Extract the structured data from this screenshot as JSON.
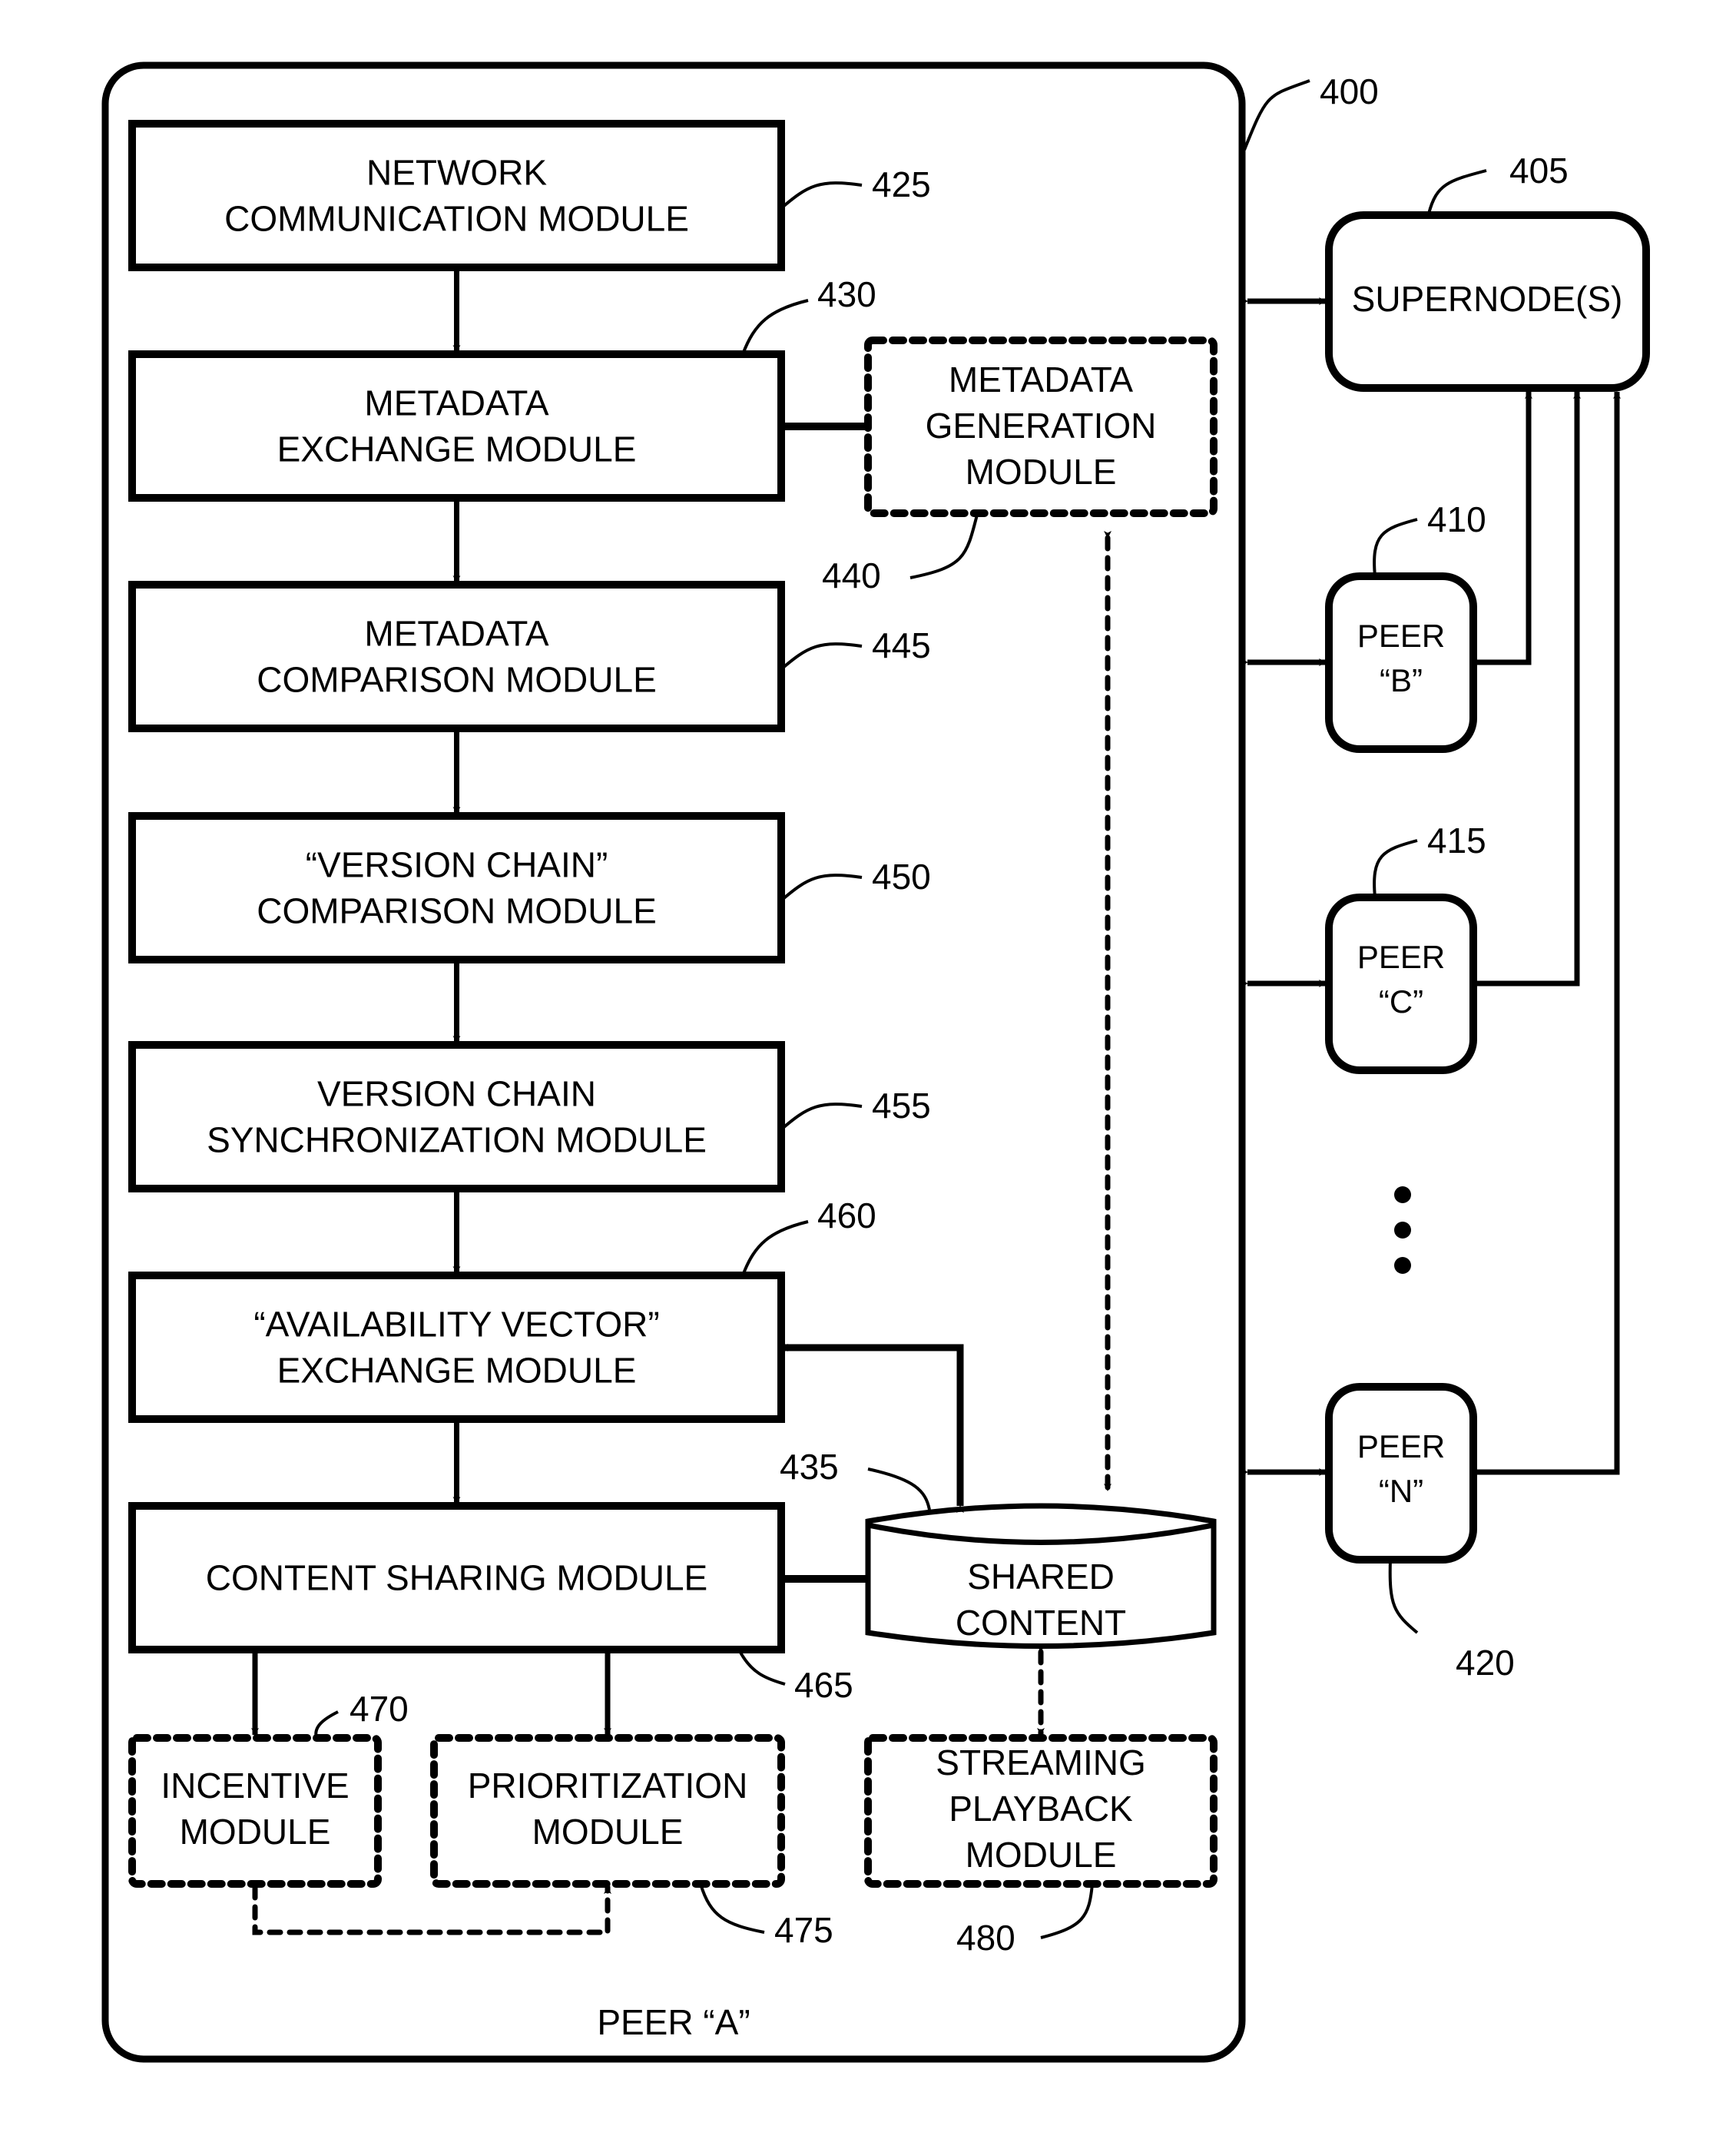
{
  "figure": {
    "container": {
      "label": "PEER “A”",
      "ref": "400"
    },
    "modules": [
      {
        "id": "network-communication",
        "lines": [
          "NETWORK",
          "COMMUNICATION MODULE"
        ],
        "ref": "425",
        "style": "solid"
      },
      {
        "id": "metadata-exchange",
        "lines": [
          "METADATA",
          "EXCHANGE MODULE"
        ],
        "ref": "430",
        "style": "solid"
      },
      {
        "id": "metadata-comparison",
        "lines": [
          "METADATA",
          "COMPARISON MODULE"
        ],
        "ref": "445",
        "style": "solid"
      },
      {
        "id": "version-chain-comparison",
        "lines": [
          "“VERSION CHAIN”",
          "COMPARISON MODULE"
        ],
        "ref": "450",
        "style": "solid"
      },
      {
        "id": "version-chain-sync",
        "lines": [
          "VERSION CHAIN",
          "SYNCHRONIZATION MODULE"
        ],
        "ref": "455",
        "style": "solid"
      },
      {
        "id": "availability-vector-exchange",
        "lines": [
          "“AVAILABILITY VECTOR”",
          "EXCHANGE MODULE"
        ],
        "ref": "460",
        "style": "solid"
      },
      {
        "id": "content-sharing",
        "lines": [
          "CONTENT SHARING MODULE"
        ],
        "ref": "465",
        "style": "solid"
      }
    ],
    "optional_modules": [
      {
        "id": "metadata-generation",
        "lines": [
          "METADATA",
          "GENERATION",
          "MODULE"
        ],
        "ref": "440",
        "style": "dashed"
      },
      {
        "id": "incentive",
        "lines": [
          "INCENTIVE",
          "MODULE"
        ],
        "ref": "470",
        "style": "dashed"
      },
      {
        "id": "prioritization",
        "lines": [
          "PRIORITIZATION",
          "MODULE"
        ],
        "ref": "475",
        "style": "dashed"
      },
      {
        "id": "streaming-playback",
        "lines": [
          "STREAMING",
          "PLAYBACK",
          "MODULE"
        ],
        "ref": "480",
        "style": "dashed"
      }
    ],
    "datastore": {
      "id": "shared-content",
      "lines": [
        "SHARED",
        "CONTENT"
      ],
      "ref": "435"
    },
    "external_nodes": [
      {
        "id": "supernode",
        "lines": [
          "SUPERNODE(S)"
        ],
        "ref": "405"
      },
      {
        "id": "peer-b",
        "lines": [
          "PEER",
          "“B”"
        ],
        "ref": "410"
      },
      {
        "id": "peer-c",
        "lines": [
          "PEER",
          "“C”"
        ],
        "ref": "415"
      },
      {
        "id": "peer-n",
        "lines": [
          "PEER",
          "“N”"
        ],
        "ref": "420"
      }
    ],
    "ellipsis": "⋮",
    "connections": [
      {
        "from": "network-communication",
        "to": "metadata-exchange",
        "type": "solid-arrow"
      },
      {
        "from": "metadata-exchange",
        "to": "metadata-comparison",
        "type": "solid-arrow"
      },
      {
        "from": "metadata-comparison",
        "to": "version-chain-comparison",
        "type": "solid-arrow"
      },
      {
        "from": "version-chain-comparison",
        "to": "version-chain-sync",
        "type": "solid-arrow"
      },
      {
        "from": "version-chain-sync",
        "to": "availability-vector-exchange",
        "type": "solid-arrow"
      },
      {
        "from": "availability-vector-exchange",
        "to": "content-sharing",
        "type": "solid-arrow"
      },
      {
        "from": "metadata-exchange",
        "to": "metadata-generation",
        "type": "solid-arrow"
      },
      {
        "from": "availability-vector-exchange",
        "to": "shared-content",
        "type": "solid-bidirectional"
      },
      {
        "from": "metadata-generation",
        "to": "shared-content",
        "type": "dashed-bidirectional"
      },
      {
        "from": "content-sharing",
        "to": "shared-content",
        "type": "solid-arrow"
      },
      {
        "from": "content-sharing",
        "to": "incentive",
        "type": "solid-bidirectional"
      },
      {
        "from": "content-sharing",
        "to": "prioritization",
        "type": "solid-bidirectional"
      },
      {
        "from": "incentive",
        "to": "prioritization",
        "type": "dashed-bidirectional"
      },
      {
        "from": "shared-content",
        "to": "streaming-playback",
        "type": "dashed-bidirectional"
      },
      {
        "from": "peer-a",
        "to": "supernode",
        "type": "solid-bidirectional"
      },
      {
        "from": "peer-a",
        "to": "peer-b",
        "type": "solid-bidirectional"
      },
      {
        "from": "peer-a",
        "to": "peer-c",
        "type": "solid-bidirectional"
      },
      {
        "from": "peer-a",
        "to": "peer-n",
        "type": "solid-bidirectional"
      },
      {
        "from": "peer-b",
        "to": "supernode",
        "type": "solid-bidirectional"
      },
      {
        "from": "peer-c",
        "to": "supernode",
        "type": "solid-bidirectional"
      },
      {
        "from": "peer-n",
        "to": "supernode",
        "type": "solid-bidirectional"
      }
    ]
  }
}
